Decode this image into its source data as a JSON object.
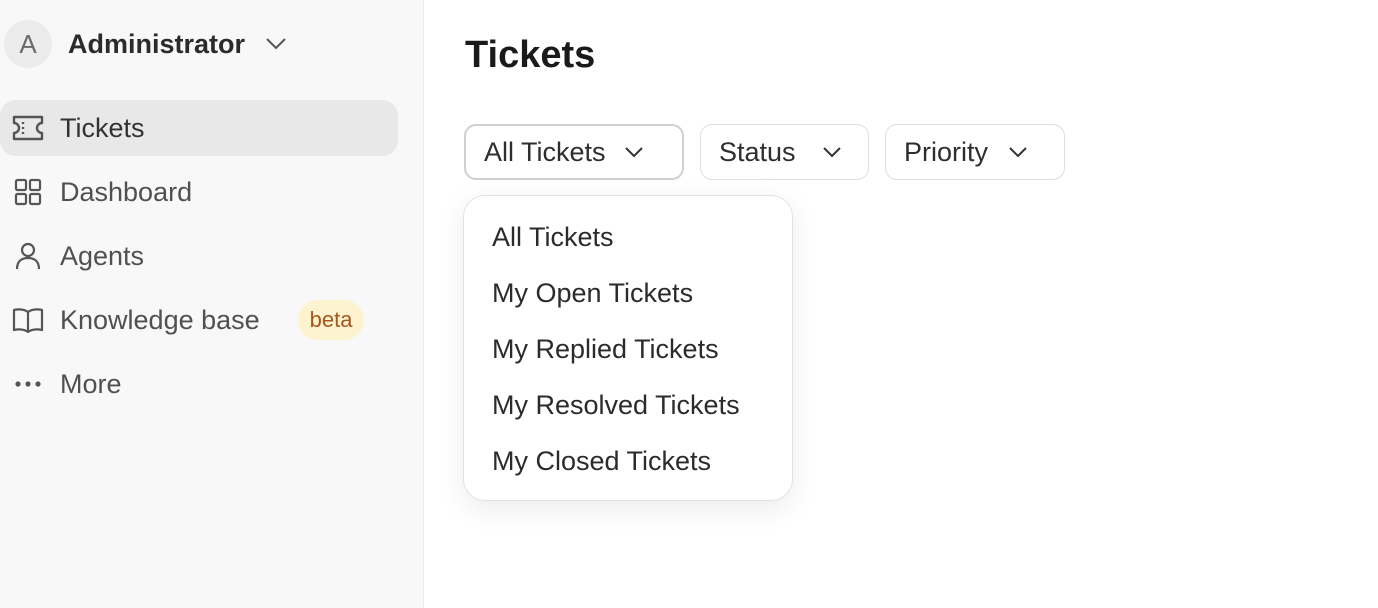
{
  "account": {
    "initial": "A",
    "name": "Administrator"
  },
  "sidebar": {
    "items": [
      {
        "label": "Tickets",
        "icon": "ticket-icon",
        "active": true
      },
      {
        "label": "Dashboard",
        "icon": "dashboard-icon"
      },
      {
        "label": "Agents",
        "icon": "user-icon"
      },
      {
        "label": "Knowledge base",
        "icon": "book-icon",
        "badge": "beta"
      },
      {
        "label": "More",
        "icon": "more-icon"
      }
    ]
  },
  "page": {
    "title": "Tickets"
  },
  "filters": [
    {
      "label": "All Tickets",
      "open": true
    },
    {
      "label": "Status"
    },
    {
      "label": "Priority"
    }
  ],
  "dropdown": {
    "options": [
      "All Tickets",
      "My Open Tickets",
      "My Replied Tickets",
      "My Resolved Tickets",
      "My Closed Tickets"
    ]
  },
  "colors": {
    "badge_bg": "#fdf3cf",
    "badge_text": "#a8561b",
    "active_nav": "#e8e8e8"
  }
}
